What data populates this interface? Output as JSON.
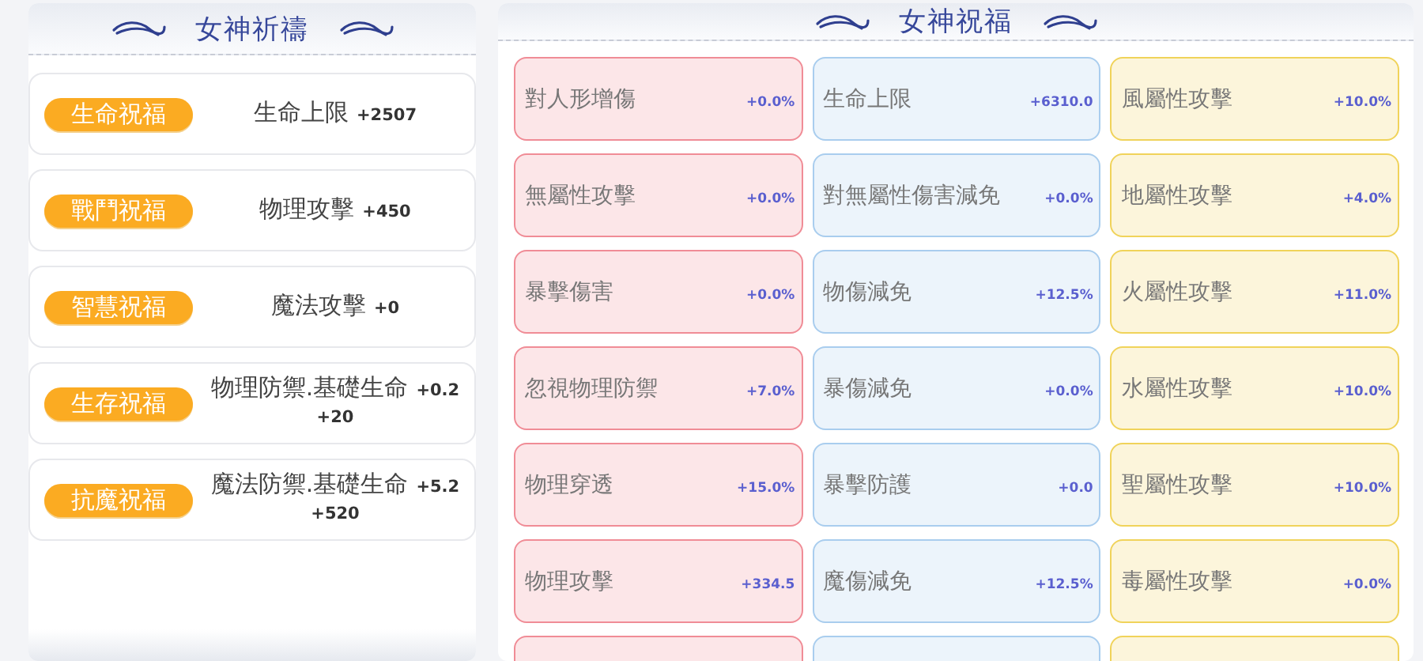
{
  "prayer_panel": {
    "title": "女神祈禱",
    "blessings": [
      {
        "badge": "生命祝福",
        "stat": "生命上限",
        "values": [
          "+2507"
        ]
      },
      {
        "badge": "戰鬥祝福",
        "stat": "物理攻擊",
        "values": [
          "+450"
        ]
      },
      {
        "badge": "智慧祝福",
        "stat": "魔法攻擊",
        "values": [
          "+0"
        ]
      },
      {
        "badge": "生存祝福",
        "stat": "物理防禦.基礎生命",
        "values": [
          "+0.2",
          "+20"
        ]
      },
      {
        "badge": "抗魔祝福",
        "stat": "魔法防禦.基礎生命",
        "values": [
          "+5.2",
          "+520"
        ]
      }
    ]
  },
  "blessing_panel": {
    "title": "女神祝福",
    "columns": [
      {
        "color": "#f08c96",
        "cut_off_card_below": true,
        "cards": [
          {
            "name": "對人形增傷",
            "value": "+0.0%"
          },
          {
            "name": "無屬性攻擊",
            "value": "+0.0%"
          },
          {
            "name": "暴擊傷害",
            "value": "+0.0%"
          },
          {
            "name": "忽視物理防禦",
            "value": "+7.0%"
          },
          {
            "name": "物理穿透",
            "value": "+15.0%"
          },
          {
            "name": "物理攻擊",
            "value": "+334.5"
          }
        ]
      },
      {
        "color": "#a9cdee",
        "cut_off_card_below": true,
        "cards": [
          {
            "name": "生命上限",
            "value": "+6310.0"
          },
          {
            "name": "對無屬性傷害減免",
            "value": "+0.0%"
          },
          {
            "name": "物傷減免",
            "value": "+12.5%"
          },
          {
            "name": "暴傷減免",
            "value": "+0.0%"
          },
          {
            "name": "暴擊防護",
            "value": "+0.0"
          },
          {
            "name": "魔傷減免",
            "value": "+12.5%"
          }
        ]
      },
      {
        "color": "#f0d35a",
        "cut_off_card_below": true,
        "cards": [
          {
            "name": "風屬性攻擊",
            "value": "+10.0%"
          },
          {
            "name": "地屬性攻擊",
            "value": "+4.0%"
          },
          {
            "name": "火屬性攻擊",
            "value": "+11.0%"
          },
          {
            "name": "水屬性攻擊",
            "value": "+10.0%"
          },
          {
            "name": "聖屬性攻擊",
            "value": "+10.0%"
          },
          {
            "name": "毒屬性攻擊",
            "value": "+0.0%"
          }
        ]
      }
    ]
  }
}
